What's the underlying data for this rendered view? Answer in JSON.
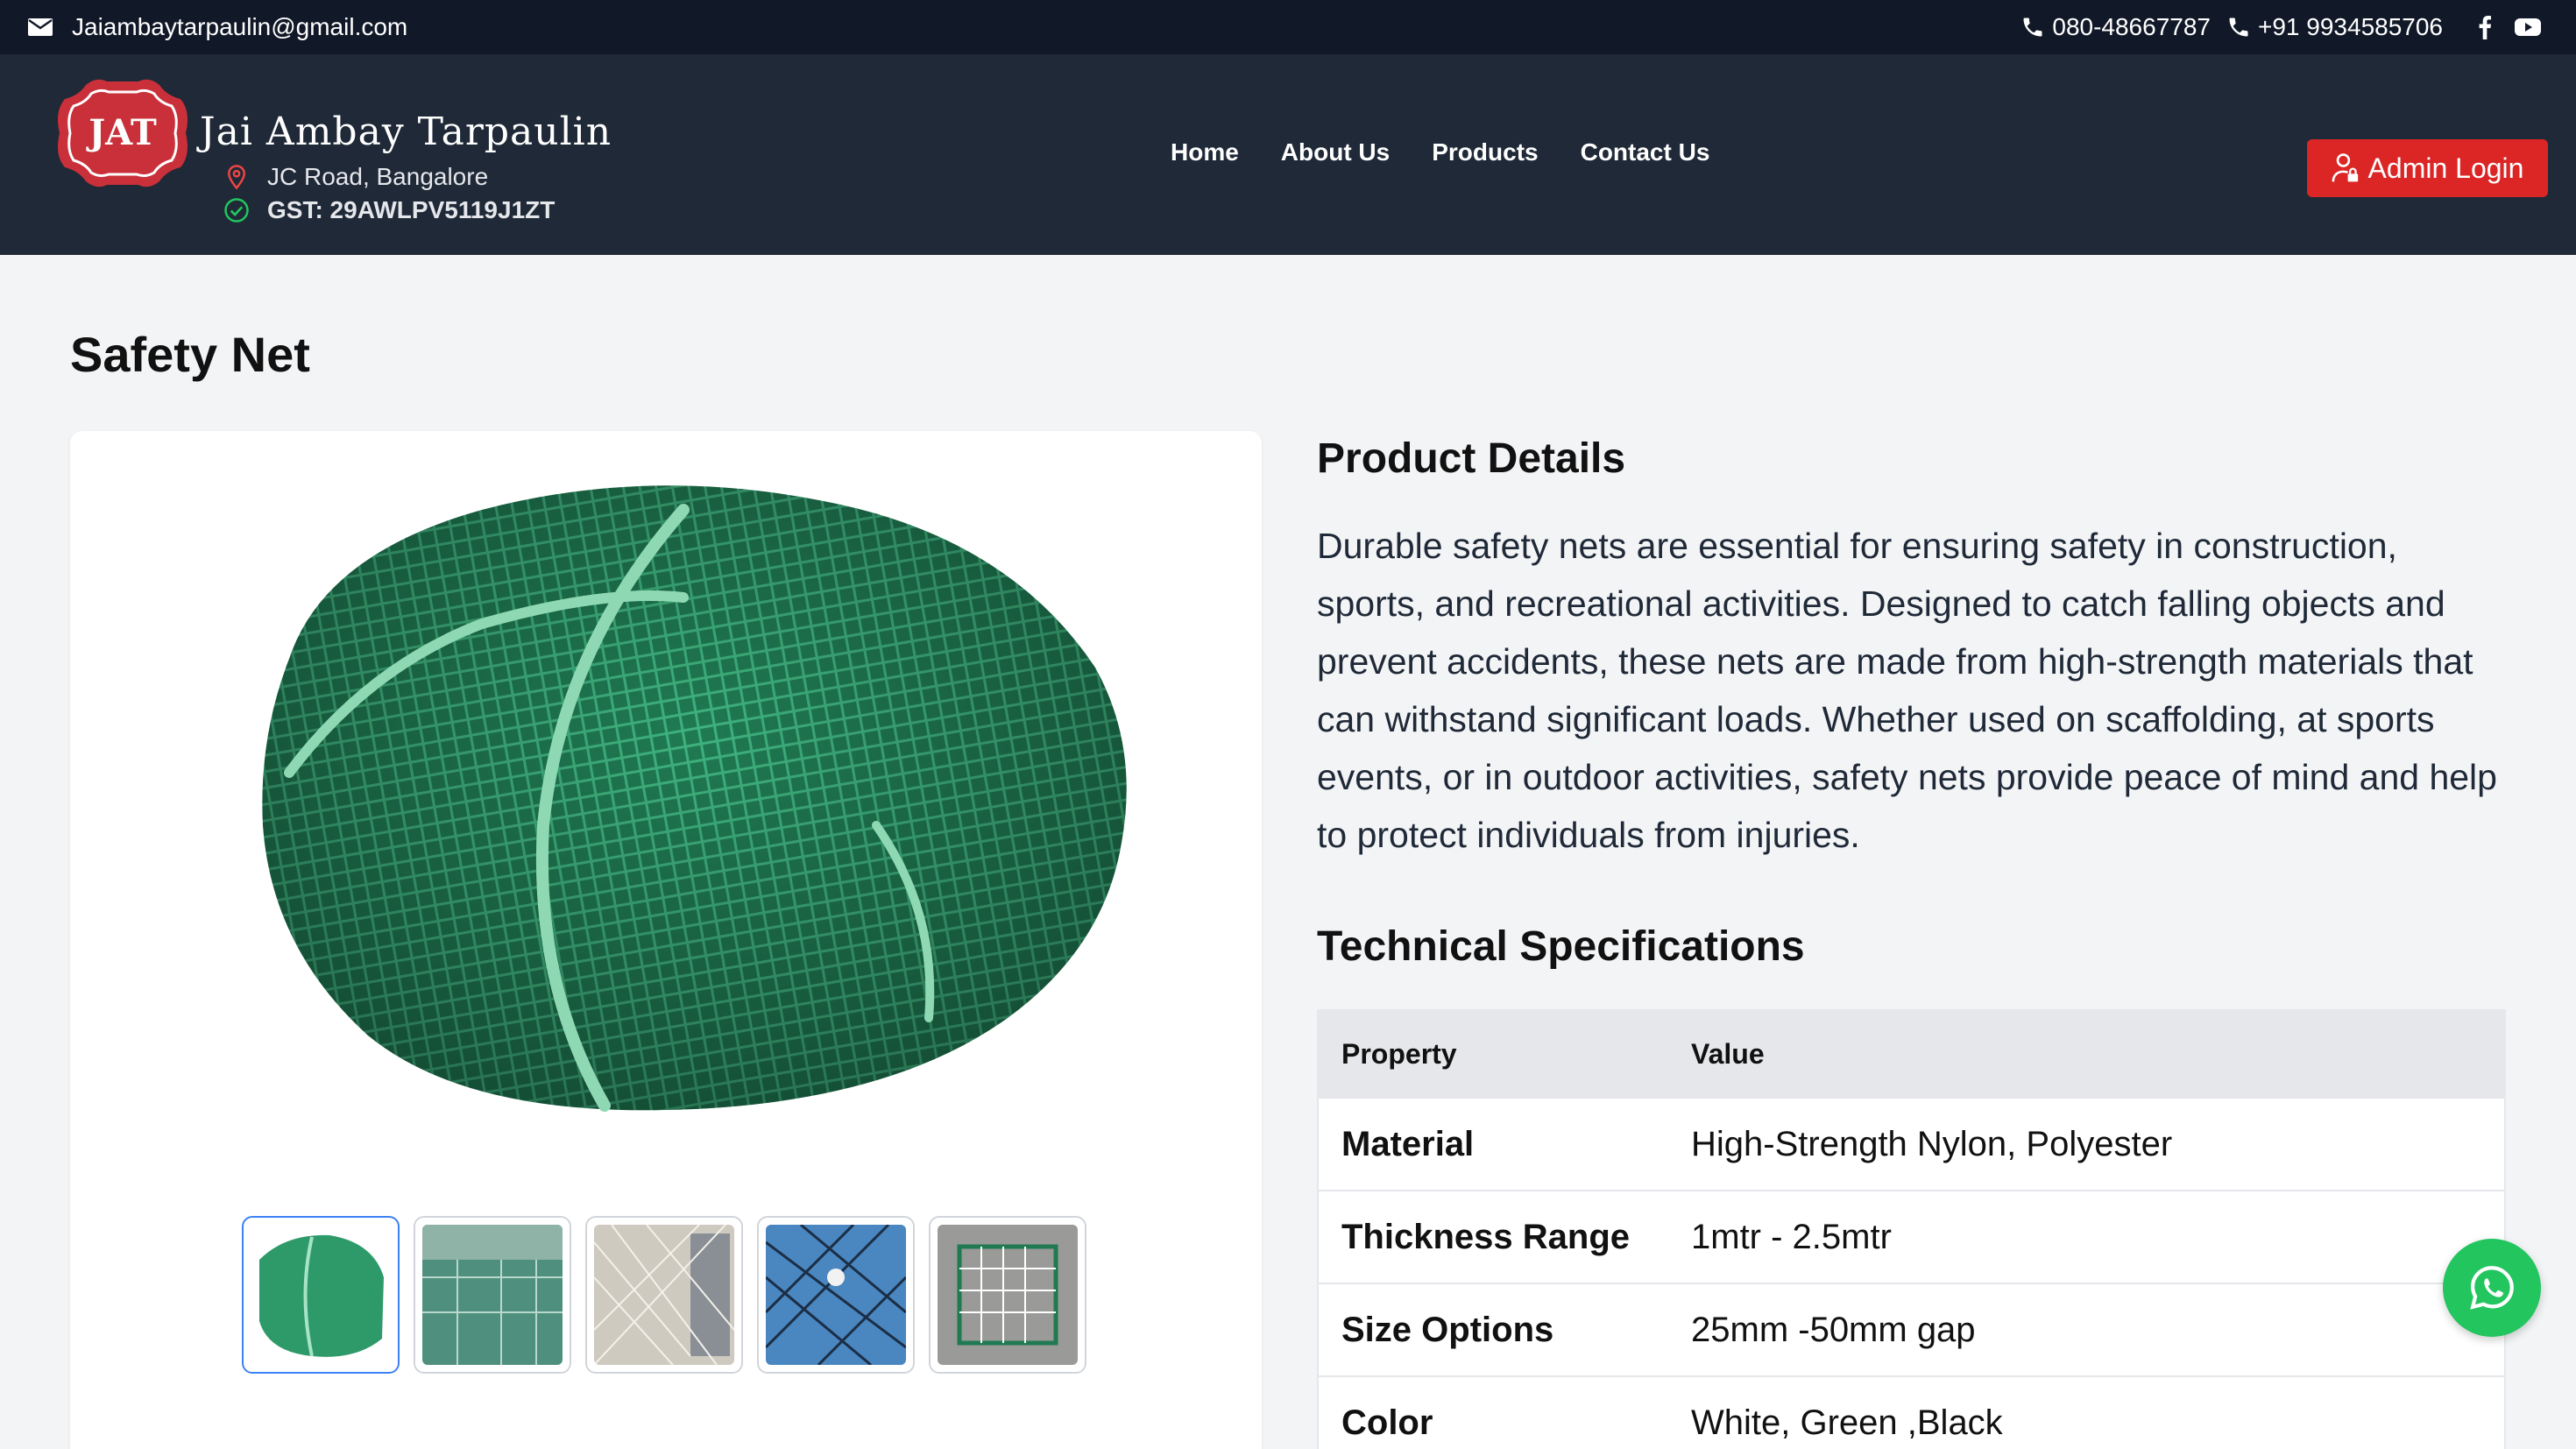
{
  "topbar": {
    "email": "Jaiambaytarpaulin@gmail.com",
    "phone1": "080-48667787",
    "phone2": "+91 9934585706",
    "social_icons": [
      "facebook-icon",
      "youtube-icon"
    ]
  },
  "header": {
    "logo_text": "JAT",
    "brand_name": "Jai Ambay Tarpaulin",
    "address": "JC Road, Bangalore",
    "gst": "GST: 29AWLPV5119J1ZT",
    "nav": [
      "Home",
      "About Us",
      "Products",
      "Contact Us"
    ],
    "admin_button": "Admin Login"
  },
  "page": {
    "title": "Safety Net"
  },
  "gallery": {
    "thumbnail_count": 5,
    "active_thumbnail": 1
  },
  "details": {
    "heading": "Product Details",
    "description": "Durable safety nets are essential for ensuring safety in construction, sports, and recreational activities. Designed to catch falling objects and prevent accidents, these nets are made from high-strength materials that can withstand significant loads. Whether used on scaffolding, at sports events, or in outdoor activities, safety nets provide peace of mind and help to protect individuals from injuries."
  },
  "specs": {
    "heading": "Technical Specifications",
    "columns": [
      "Property",
      "Value"
    ],
    "rows": [
      {
        "property": "Material",
        "value": "High-Strength Nylon, Polyester"
      },
      {
        "property": "Thickness Range",
        "value": "1mtr - 2.5mtr"
      },
      {
        "property": "Size Options",
        "value": "25mm -50mm gap"
      },
      {
        "property": "Color",
        "value": "White, Green ,Black"
      }
    ]
  },
  "colors": {
    "topbar_bg": "#111827",
    "header_bg": "#1f2937",
    "accent_red": "#dc2626",
    "net_green": "#2e9a6a",
    "whatsapp_green": "#22c55e"
  }
}
